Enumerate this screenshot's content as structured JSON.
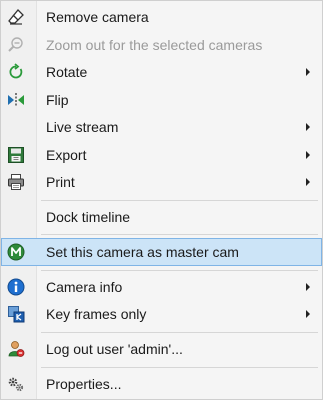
{
  "menu": {
    "items": [
      {
        "label": "Remove camera",
        "icon": "eraser-icon",
        "enabled": true,
        "submenu": false
      },
      {
        "label": "Zoom out for the selected cameras",
        "icon": "zoom-out-icon",
        "enabled": false,
        "submenu": false
      },
      {
        "label": "Rotate",
        "icon": "rotate-icon",
        "enabled": true,
        "submenu": true
      },
      {
        "label": "Flip",
        "icon": "flip-icon",
        "enabled": true,
        "submenu": false
      },
      {
        "label": "Live stream",
        "icon": "",
        "enabled": true,
        "submenu": true
      },
      {
        "label": "Export",
        "icon": "export-icon",
        "enabled": true,
        "submenu": true
      },
      {
        "label": "Print",
        "icon": "print-icon",
        "enabled": true,
        "submenu": true
      },
      {
        "label": "Dock timeline",
        "icon": "",
        "enabled": true,
        "submenu": false
      },
      {
        "label": "Set this camera as master cam",
        "icon": "master-cam-icon",
        "enabled": true,
        "submenu": false,
        "highlighted": true
      },
      {
        "label": "Camera info",
        "icon": "info-icon",
        "enabled": true,
        "submenu": true
      },
      {
        "label": "Key frames only",
        "icon": "key-frames-icon",
        "enabled": true,
        "submenu": true
      },
      {
        "label": "Log out user 'admin'...",
        "icon": "logout-user-icon",
        "enabled": true,
        "submenu": false
      },
      {
        "label": "Properties...",
        "icon": "gears-icon",
        "enabled": true,
        "submenu": false
      }
    ]
  },
  "colors": {
    "highlight_bg": "#cce4f7",
    "highlight_border": "#7fb4e6",
    "master_badge": "#2e8b3a",
    "info_blue": "#1e6fd0"
  }
}
